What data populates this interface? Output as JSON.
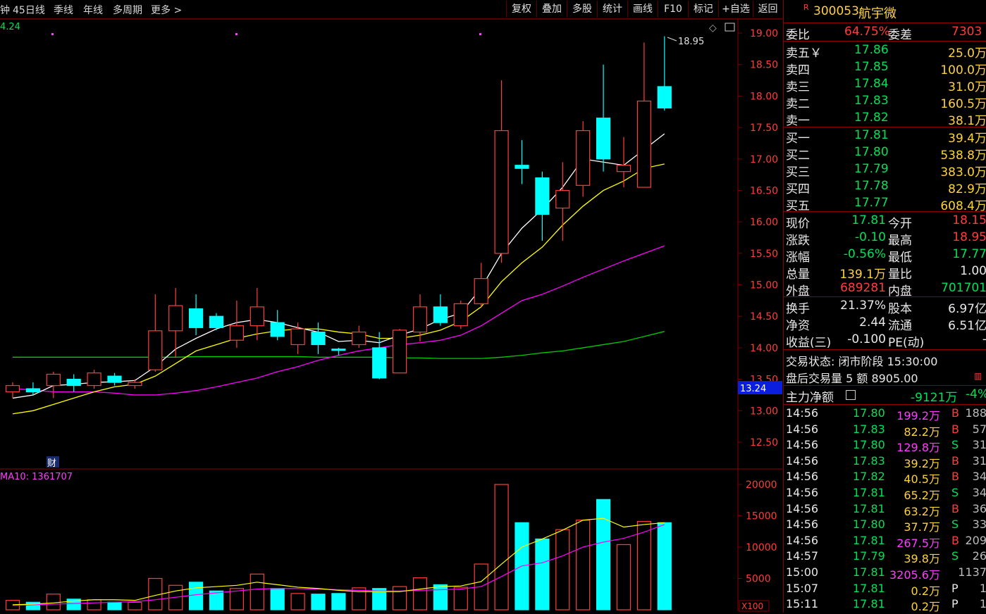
{
  "toolbar": {
    "left_items": [
      "钟",
      "45日线",
      "季线",
      "年线",
      "多周期",
      "更多 >"
    ],
    "right_buttons": [
      "复权",
      "叠加",
      "多股",
      "统计",
      "画线",
      "F10",
      "标记",
      "+自选",
      "返回"
    ]
  },
  "chart": {
    "corner_value": "4.24",
    "high_marker_label": "18.95",
    "price_tag": "13.24",
    "cai_label": "财",
    "volume_label": "MA10: 1361707",
    "volume_unit": "X100",
    "price_ticks": [
      "19.00",
      "18.50",
      "18.00",
      "17.50",
      "17.00",
      "16.50",
      "16.00",
      "15.50",
      "15.00",
      "14.50",
      "14.00",
      "13.50",
      "13.00",
      "12.50"
    ],
    "volume_ticks": [
      "20000",
      "15000",
      "10000",
      "5000"
    ],
    "colors": {
      "up": "#ff3c3c",
      "down": "#00ffff",
      "ma5": "#ffffff",
      "ma10": "#ffff00",
      "ma20": "#ff00ff",
      "ma60": "#00cc00",
      "grid": "#7a0000"
    }
  },
  "chart_data": {
    "type": "candlestick",
    "price_range": [
      12.2,
      19.2
    ],
    "volume_range": [
      0,
      20000
    ],
    "candles": [
      {
        "o": 13.3,
        "h": 13.45,
        "l": 13.2,
        "c": 13.4
      },
      {
        "o": 13.35,
        "h": 13.45,
        "l": 13.25,
        "c": 13.3
      },
      {
        "o": 13.4,
        "h": 13.62,
        "l": 13.2,
        "c": 13.58
      },
      {
        "o": 13.5,
        "h": 13.58,
        "l": 13.3,
        "c": 13.4
      },
      {
        "o": 13.4,
        "h": 13.65,
        "l": 13.35,
        "c": 13.6
      },
      {
        "o": 13.55,
        "h": 13.6,
        "l": 13.4,
        "c": 13.45
      },
      {
        "o": 13.4,
        "h": 13.5,
        "l": 13.35,
        "c": 13.45
      },
      {
        "o": 13.65,
        "h": 14.85,
        "l": 13.62,
        "c": 14.27
      },
      {
        "o": 14.27,
        "h": 14.95,
        "l": 13.85,
        "c": 14.67
      },
      {
        "o": 14.62,
        "h": 14.85,
        "l": 14.2,
        "c": 14.32
      },
      {
        "o": 14.5,
        "h": 14.55,
        "l": 14.28,
        "c": 14.32
      },
      {
        "o": 14.12,
        "h": 14.75,
        "l": 14.0,
        "c": 14.35
      },
      {
        "o": 14.35,
        "h": 14.95,
        "l": 14.12,
        "c": 14.65
      },
      {
        "o": 14.4,
        "h": 14.6,
        "l": 14.12,
        "c": 14.18
      },
      {
        "o": 14.05,
        "h": 14.4,
        "l": 13.9,
        "c": 14.3
      },
      {
        "o": 14.25,
        "h": 14.4,
        "l": 13.9,
        "c": 14.05
      },
      {
        "o": 13.98,
        "h": 14.0,
        "l": 13.88,
        "c": 13.96
      },
      {
        "o": 14.05,
        "h": 14.35,
        "l": 14.0,
        "c": 14.25
      },
      {
        "o": 14.0,
        "h": 14.25,
        "l": 13.5,
        "c": 13.52
      },
      {
        "o": 13.6,
        "h": 14.3,
        "l": 13.6,
        "c": 14.28
      },
      {
        "o": 14.25,
        "h": 14.85,
        "l": 14.1,
        "c": 14.65
      },
      {
        "o": 14.65,
        "h": 14.85,
        "l": 14.35,
        "c": 14.4
      },
      {
        "o": 14.35,
        "h": 14.75,
        "l": 14.3,
        "c": 14.7
      },
      {
        "o": 14.7,
        "h": 15.35,
        "l": 14.65,
        "c": 15.1
      },
      {
        "o": 15.5,
        "h": 18.25,
        "l": 15.35,
        "c": 17.45
      },
      {
        "o": 16.9,
        "h": 17.3,
        "l": 16.6,
        "c": 16.85
      },
      {
        "o": 16.7,
        "h": 16.8,
        "l": 15.7,
        "c": 16.12
      },
      {
        "o": 16.22,
        "h": 16.95,
        "l": 15.7,
        "c": 16.5
      },
      {
        "o": 16.58,
        "h": 17.6,
        "l": 16.4,
        "c": 17.45
      },
      {
        "o": 17.65,
        "h": 18.5,
        "l": 16.8,
        "c": 17.0
      },
      {
        "o": 16.8,
        "h": 17.35,
        "l": 16.55,
        "c": 16.9
      },
      {
        "o": 16.55,
        "h": 18.85,
        "l": 16.55,
        "c": 17.92
      },
      {
        "o": 18.15,
        "h": 18.95,
        "l": 17.77,
        "c": 17.81
      }
    ],
    "volumes": [
      1500,
      1200,
      2500,
      1700,
      1600,
      1200,
      1200,
      5000,
      3900,
      4400,
      3000,
      3400,
      5700,
      3400,
      2600,
      2500,
      2600,
      3500,
      3400,
      3700,
      5100,
      4000,
      3600,
      7300,
      20000,
      13900,
      11300,
      12800,
      14300,
      17600,
      10400,
      14100,
      13900
    ],
    "ma5": [
      13.2,
      13.25,
      13.4,
      13.42,
      13.45,
      13.46,
      13.48,
      13.7,
      13.98,
      14.15,
      14.3,
      14.4,
      14.45,
      14.4,
      14.32,
      14.25,
      14.1,
      14.12,
      14.08,
      14.2,
      14.3,
      14.45,
      14.55,
      14.95,
      15.5,
      15.9,
      16.2,
      16.55,
      17.0,
      16.95,
      16.9,
      17.15,
      17.4
    ],
    "ma10": [
      12.95,
      13.0,
      13.1,
      13.2,
      13.3,
      13.38,
      13.42,
      13.55,
      13.75,
      13.95,
      14.05,
      14.15,
      14.22,
      14.27,
      14.3,
      14.3,
      14.25,
      14.22,
      14.15,
      14.15,
      14.2,
      14.28,
      14.42,
      14.65,
      15.05,
      15.35,
      15.6,
      15.95,
      16.25,
      16.5,
      16.65,
      16.85,
      16.92
    ],
    "ma20": [
      13.35,
      13.33,
      13.3,
      13.3,
      13.3,
      13.28,
      13.25,
      13.25,
      13.28,
      13.32,
      13.38,
      13.45,
      13.52,
      13.62,
      13.7,
      13.8,
      13.88,
      13.95,
      14.0,
      14.05,
      14.08,
      14.12,
      14.2,
      14.35,
      14.55,
      14.75,
      14.85,
      14.98,
      15.12,
      15.25,
      15.38,
      15.5,
      15.62
    ],
    "ma60": [
      13.85,
      13.85,
      13.85,
      13.85,
      13.85,
      13.85,
      13.85,
      13.85,
      13.85,
      13.86,
      13.86,
      13.86,
      13.86,
      13.86,
      13.86,
      13.85,
      13.85,
      13.85,
      13.85,
      13.84,
      13.84,
      13.83,
      13.83,
      13.83,
      13.85,
      13.88,
      13.92,
      13.95,
      14.0,
      14.05,
      14.1,
      14.18,
      14.26
    ],
    "vol_ma5": [
      800,
      900,
      1100,
      1400,
      1600,
      1600,
      1500,
      2300,
      3000,
      3500,
      3700,
      3900,
      4400,
      4000,
      3600,
      3400,
      3100,
      2900,
      2900,
      2900,
      3300,
      3700,
      3800,
      4500,
      7300,
      10000,
      11300,
      12700,
      14300,
      14600,
      13200,
      13600,
      13900
    ],
    "vol_ma10": [
      700,
      800,
      900,
      1000,
      1100,
      1200,
      1300,
      1600,
      2000,
      2400,
      2700,
      3000,
      3300,
      3400,
      3400,
      3300,
      3200,
      3100,
      3000,
      3000,
      3100,
      3200,
      3300,
      3700,
      5300,
      7000,
      7500,
      8600,
      10000,
      10800,
      11400,
      12400,
      13600
    ]
  },
  "panel": {
    "code_prefix": "R",
    "code": "300053",
    "name": "航宇微",
    "weibi": {
      "label": "委比",
      "value": "64.75%",
      "label2": "委差",
      "value2": "7303"
    },
    "asks": [
      {
        "label": "卖五￥",
        "price": "17.86",
        "vol": "25.0万"
      },
      {
        "label": "卖四",
        "price": "17.85",
        "vol": "100.0万"
      },
      {
        "label": "卖三",
        "price": "17.84",
        "vol": "31.0万"
      },
      {
        "label": "卖二",
        "price": "17.83",
        "vol": "160.5万"
      },
      {
        "label": "卖一",
        "price": "17.82",
        "vol": "38.1万"
      }
    ],
    "bids": [
      {
        "label": "买一",
        "price": "17.81",
        "vol": "39.4万"
      },
      {
        "label": "买二",
        "price": "17.80",
        "vol": "538.8万"
      },
      {
        "label": "买三",
        "price": "17.79",
        "vol": "383.0万"
      },
      {
        "label": "买四",
        "price": "17.78",
        "vol": "82.9万"
      },
      {
        "label": "买五",
        "price": "17.77",
        "vol": "608.4万"
      }
    ],
    "stats": [
      {
        "l1": "现价",
        "v1": "17.81",
        "c1": "green",
        "l2": "今开",
        "v2": "18.15",
        "c2": "red"
      },
      {
        "l1": "涨跌",
        "v1": "-0.10",
        "c1": "green",
        "l2": "最高",
        "v2": "18.95",
        "c2": "red"
      },
      {
        "l1": "涨幅",
        "v1": "-0.56%",
        "c1": "green",
        "l2": "最低",
        "v2": "17.77",
        "c2": "green"
      },
      {
        "l1": "总量",
        "v1": "139.1万",
        "c1": "yellow",
        "l2": "量比",
        "v2": "1.00",
        "c2": "white"
      },
      {
        "l1": "外盘",
        "v1": "689281",
        "c1": "red",
        "l2": "内盘",
        "v2": "701701",
        "c2": "green"
      }
    ],
    "stats2": [
      {
        "l1": "换手",
        "v1": "21.37%",
        "l2": "股本",
        "v2": "6.97亿"
      },
      {
        "l1": "净资",
        "v1": "2.44",
        "l2": "流通",
        "v2": "6.51亿"
      },
      {
        "l1": "收益(三)",
        "v1": "-0.100",
        "l2": "PE(动)",
        "v2": "-"
      }
    ],
    "trade_status": "交易状态: 闭市阶段 15:30:00",
    "after_hours": "盘后交易量 5 额 8905.00",
    "main_net": {
      "label": "主力净额",
      "value": "-9121万",
      "pct": "-4%"
    },
    "ticks": [
      {
        "t": "14:56",
        "p": "17.80",
        "v": "199.2万",
        "vc": "magenta",
        "s": "B",
        "n": "188"
      },
      {
        "t": "14:56",
        "p": "17.83",
        "v": "82.2万",
        "vc": "yellow",
        "s": "B",
        "n": "57"
      },
      {
        "t": "14:56",
        "p": "17.80",
        "v": "129.8万",
        "vc": "magenta",
        "s": "S",
        "n": "31"
      },
      {
        "t": "14:56",
        "p": "17.83",
        "v": "39.2万",
        "vc": "yellow",
        "s": "B",
        "n": "31"
      },
      {
        "t": "14:56",
        "p": "17.82",
        "v": "40.5万",
        "vc": "yellow",
        "s": "B",
        "n": "34"
      },
      {
        "t": "14:56",
        "p": "17.81",
        "v": "65.2万",
        "vc": "yellow",
        "s": "S",
        "n": "34"
      },
      {
        "t": "14:56",
        "p": "17.81",
        "v": "63.2万",
        "vc": "yellow",
        "s": "B",
        "n": "36"
      },
      {
        "t": "14:56",
        "p": "17.80",
        "v": "37.7万",
        "vc": "yellow",
        "s": "S",
        "n": "33"
      },
      {
        "t": "14:56",
        "p": "17.81",
        "v": "267.5万",
        "vc": "magenta",
        "s": "B",
        "n": "209"
      },
      {
        "t": "14:57",
        "p": "17.79",
        "v": "39.8万",
        "vc": "yellow",
        "s": "S",
        "n": "26"
      },
      {
        "t": "15:00",
        "p": "17.81",
        "v": "3205.6万",
        "vc": "magenta",
        "s": "",
        "n": "1137"
      },
      {
        "t": "15:07",
        "p": "17.81",
        "v": "0.2万",
        "vc": "yellow",
        "s": "P",
        "n": "1"
      },
      {
        "t": "15:11",
        "p": "17.81",
        "v": "0.2万",
        "vc": "yellow",
        "s": "P",
        "n": "1"
      }
    ]
  }
}
